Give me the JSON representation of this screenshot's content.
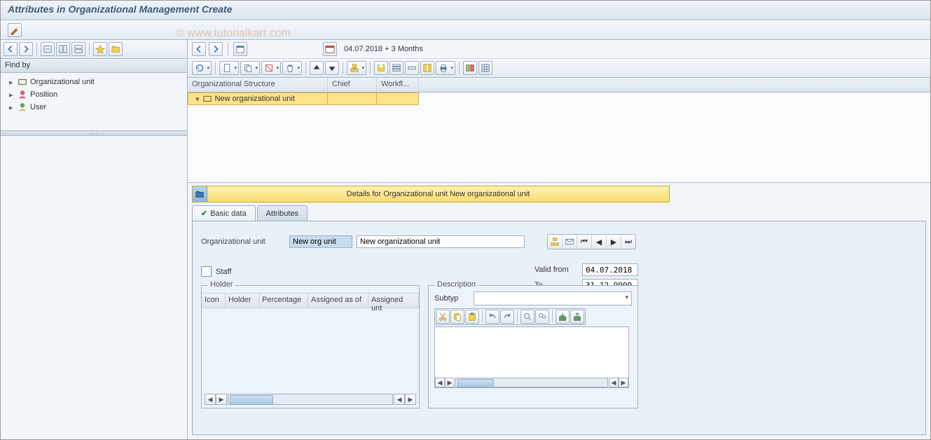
{
  "title": "Attributes in Organizational Management Create",
  "watermark": "© www.tutorialkart.com",
  "left_pane": {
    "find_by_label": "Find by",
    "tree": [
      {
        "label": "Organizational unit",
        "icon": "org-unit"
      },
      {
        "label": "Position",
        "icon": "position"
      },
      {
        "label": "User",
        "icon": "user"
      }
    ]
  },
  "nav": {
    "date": "04.07.2018",
    "period": "+ 3 Months"
  },
  "columns": {
    "org_structure": "Organizational Structure",
    "chief": "Chief",
    "workflow": "Workfl..."
  },
  "org_rows": [
    {
      "label": "New organizational unit"
    }
  ],
  "details_header": "Details for Organizational unit New organizational unit",
  "tabs": {
    "basic_data": "Basic data",
    "attributes": "Attributes"
  },
  "form": {
    "org_unit_label": "Organizational unit",
    "short_value": "New org unit",
    "long_value": "New organizational unit",
    "staff_label": "Staff",
    "valid_from_label": "Valid from",
    "valid_from_value": "04.07.2018",
    "to_label": "To",
    "to_value": "31.12.9999"
  },
  "holder": {
    "title": "Holder",
    "cols": {
      "icon": "Icon",
      "holder": "Holder",
      "percentage": "Percentage",
      "assigned_as_of": "Assigned as of",
      "assigned_until": "Assigned unt"
    }
  },
  "description": {
    "title": "Description",
    "subtyp_label": "Subtyp"
  }
}
